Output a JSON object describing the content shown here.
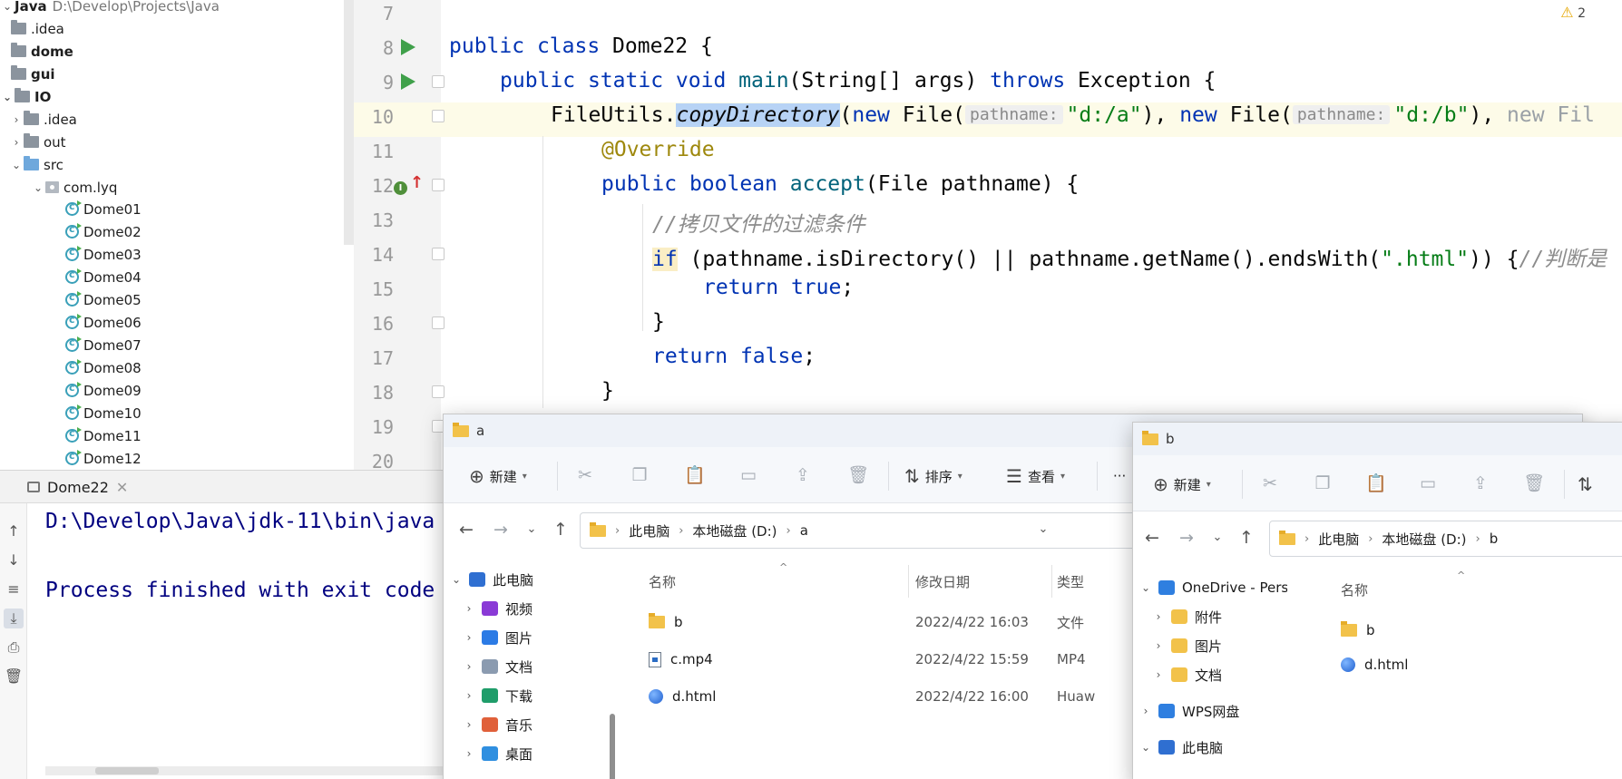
{
  "project": {
    "root_name": "Java",
    "root_path": "D:\\Develop\\Projects\\Java",
    "items": [
      {
        "label": ".idea",
        "bold": false
      },
      {
        "label": "dome",
        "bold": true
      },
      {
        "label": "gui",
        "bold": true
      },
      {
        "label": "IO",
        "bold": true
      },
      {
        "label": ".idea",
        "bold": false
      },
      {
        "label": "out",
        "bold": false
      },
      {
        "label": "src",
        "bold": false
      },
      {
        "label": "com.lyq",
        "bold": false
      }
    ],
    "classes": [
      "Dome01",
      "Dome02",
      "Dome03",
      "Dome04",
      "Dome05",
      "Dome06",
      "Dome07",
      "Dome08",
      "Dome09",
      "Dome10",
      "Dome11",
      "Dome12"
    ]
  },
  "editor": {
    "warning_count": "2",
    "line_numbers": [
      "7",
      "8",
      "9",
      "10",
      "11",
      "12",
      "13",
      "14",
      "15",
      "16",
      "17",
      "18",
      "19",
      "20"
    ],
    "lines": {
      "l8": {
        "kw1": "public",
        "kw2": "class",
        "rest": " Dome22 {"
      },
      "l9": {
        "kw1": "public",
        "kw2": "static",
        "kw3": "void",
        "fn": "main",
        "mid": "(String[] args) ",
        "kw4": "throws",
        "rest": " Exception {"
      },
      "l10": {
        "obj": "FileUtils.",
        "method": "copyDirectory",
        "p1": "(",
        "kw_new1": "new",
        "file1": " File(",
        "hint1": "pathname:",
        "str1": "\"d:/a\"",
        "comma1": "), ",
        "kw_new2": "new",
        "file2": " File(",
        "hint2": "pathname:",
        "str2": "\"d:/b\"",
        "comma2": "), ",
        "tail": "new Fil"
      },
      "l11": {
        "annotation": "@Override"
      },
      "l12": {
        "kw1": "public",
        "kw2": "boolean",
        "fn": "accept",
        "rest": "(File pathname) {"
      },
      "l13": {
        "comment": "//拷贝文件的过滤条件"
      },
      "l14": {
        "kw_if": "if",
        "cond": " (pathname.isDirectory() || pathname.getName().endsWith(",
        "str": "\".html\"",
        "close": ")) {",
        "comment": "//判断是"
      },
      "l15": {
        "kw_return": "return",
        "kw_true": "true",
        "semi": ";"
      },
      "l16": {
        "brace": "}"
      },
      "l17": {
        "kw_return": "return",
        "kw_false": "false",
        "semi": ";"
      },
      "l18": {
        "brace": "}"
      }
    }
  },
  "run": {
    "tab_label": "Dome22",
    "line1": "D:\\Develop\\Java\\jdk-11\\bin\\java",
    "line2": "Process finished with exit code"
  },
  "explorer_a": {
    "title": "a",
    "cmd_new": "新建",
    "cmd_sort": "排序",
    "cmd_view": "查看",
    "cmd_more": "···",
    "breadcrumb": [
      "此电脑",
      "本地磁盘 (D:)",
      "a"
    ],
    "nav": [
      {
        "label": "此电脑",
        "color": "#2f6fd1"
      },
      {
        "label": "视频",
        "color": "#8a3ad6"
      },
      {
        "label": "图片",
        "color": "#2c7be5"
      },
      {
        "label": "文档",
        "color": "#8b9bb0"
      },
      {
        "label": "下载",
        "color": "#1f9d6a"
      },
      {
        "label": "音乐",
        "color": "#e0603a"
      },
      {
        "label": "桌面",
        "color": "#2f8fe0"
      }
    ],
    "columns": {
      "name": "名称",
      "modified": "修改日期",
      "type": "类型"
    },
    "files": [
      {
        "name": "b",
        "modified": "2022/4/22 16:03",
        "type": "文件",
        "icon": "folder"
      },
      {
        "name": "c.mp4",
        "modified": "2022/4/22 15:59",
        "type": "MP4",
        "icon": "video"
      },
      {
        "name": "d.html",
        "modified": "2022/4/22 16:00",
        "type": "Huaw",
        "icon": "web"
      }
    ]
  },
  "explorer_b": {
    "title": "b",
    "cmd_new": "新建",
    "breadcrumb": [
      "此电脑",
      "本地磁盘 (D:)",
      "b"
    ],
    "nav": [
      {
        "label": "OneDrive - Perso"
      },
      {
        "label": "附件"
      },
      {
        "label": "图片"
      },
      {
        "label": "文档"
      },
      {
        "label": "WPS网盘"
      },
      {
        "label": "此电脑"
      }
    ],
    "columns": {
      "name": "名称"
    },
    "files": [
      {
        "name": "b",
        "icon": "folder"
      },
      {
        "name": "d.html",
        "icon": "web"
      }
    ]
  }
}
